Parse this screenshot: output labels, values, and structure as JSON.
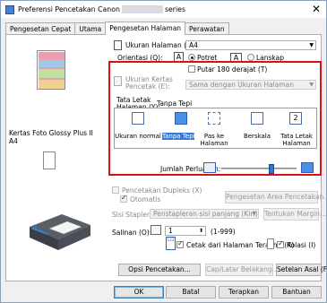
{
  "window": {
    "title_prefix": "Preferensi Pencetakan Canon",
    "title_suffix": "series",
    "close_glyph": "✕"
  },
  "tabs": [
    {
      "label": "Pengesetan Cepat"
    },
    {
      "label": "Utama"
    },
    {
      "label": "Pengesetan Halaman"
    },
    {
      "label": "Perawatan"
    }
  ],
  "preview": {
    "media": "Kertas Foto Glossy Plus II",
    "size": "A4"
  },
  "page_size": {
    "label": "Ukuran Halaman (Z):",
    "value": "A4"
  },
  "orientation": {
    "label": "Orientasi (Q):",
    "portrait": "Potret",
    "landscape": "Lanskap",
    "rotate180": "Putar 180 derajat (T)",
    "portrait_selected": true
  },
  "printer_paper": {
    "label_line1": "Ukuran Kertas",
    "label_line2": "Pencetak (E):",
    "value": "Sama dengan Ukuran Halaman"
  },
  "layout": {
    "label_line1": "Tata Letak",
    "label_line2": "Halaman (Y):",
    "borderless_label": "Tanpa Tepi",
    "options": [
      {
        "line1": "Ukuran normal",
        "line2": ""
      },
      {
        "line1": "Tanpa Tepi",
        "line2": ""
      },
      {
        "line1": "Pas ke",
        "line2": "Halaman"
      },
      {
        "line1": "Berskala",
        "line2": ""
      },
      {
        "line1": "Tata Letak",
        "line2": "Halaman"
      }
    ],
    "selected_index": 1
  },
  "extension": {
    "label": "Jumlah Perluasan:"
  },
  "duplex": {
    "label": "Pencetakan Dupleks (X)",
    "auto_label": "Otomatis",
    "area_button": "Pengesetan Area Pencetakan..."
  },
  "stapling": {
    "label": "Sisi Stapler (I):",
    "value": "Penstapleran sisi panjang (Kiri)",
    "margin_button": "Tentukan Margin..."
  },
  "copies": {
    "label": "Salinan (O):",
    "value": "1",
    "range": "(1-999)",
    "last_page_first": "Cetak dari Halaman Terakhir (R)",
    "collate": "Kolasi (I)",
    "icon_digits": "123"
  },
  "buttons": {
    "print_options": "Opsi Pencetakan...",
    "stamp": "Cap/Latar Belakang...",
    "defaults": "Setelan Asal (F)"
  },
  "footer": {
    "ok": "OK",
    "cancel": "Batal",
    "apply": "Terapkan",
    "help": "Bantuan"
  }
}
